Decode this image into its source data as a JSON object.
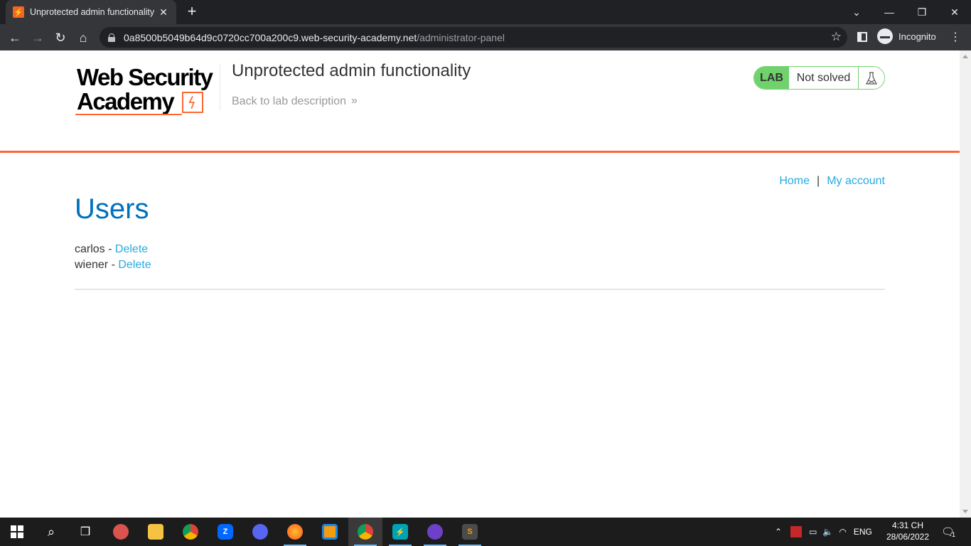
{
  "browser": {
    "tab_title": "Unprotected admin functionality",
    "tab_favicon": "⚡",
    "url_host": "0a8500b5049b64d9c0720cc700a200c9.web-security-academy.net",
    "url_path": "/administrator-panel",
    "incognito_label": "Incognito"
  },
  "header": {
    "logo_line1": "Web Security",
    "logo_line2": "Academy",
    "lab_title": "Unprotected admin functionality",
    "back_link": "Back to lab description",
    "back_arrow": "»",
    "lab_badge": "LAB",
    "lab_state": "Not solved"
  },
  "nav": {
    "home": "Home",
    "separator": "|",
    "my_account": "My account"
  },
  "main": {
    "title": "Users",
    "users": [
      {
        "name": "carlos",
        "sep": " - ",
        "action": "Delete"
      },
      {
        "name": "wiener",
        "sep": " - ",
        "action": "Delete"
      }
    ]
  },
  "taskbar": {
    "tray_lang": "ENG",
    "time": "4:31 CH",
    "date": "28/06/2022",
    "notification_count": "1",
    "apps": [
      "start",
      "search",
      "task-view",
      "paint",
      "file-explorer",
      "chrome",
      "zalo",
      "discord",
      "firefox",
      "vmware",
      "chrome-active",
      "burp",
      "github",
      "sublime"
    ]
  },
  "colors": {
    "accent_orange": "#ff6633",
    "lab_green": "#70d16d",
    "link_blue": "#29a9e0",
    "title_blue": "#0071bc"
  }
}
